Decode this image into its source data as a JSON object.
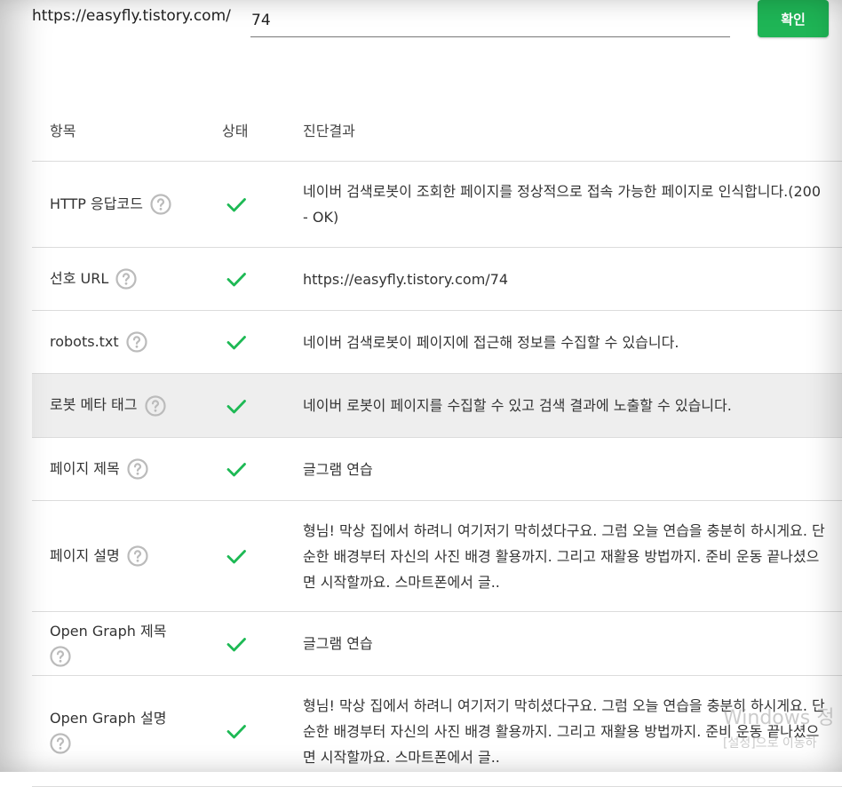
{
  "url_bar": {
    "prefix": "https://easyfly.tistory.com/",
    "value": "74",
    "confirm_label": "확인"
  },
  "table": {
    "headers": {
      "item": "항목",
      "status": "상태",
      "result": "진단결과"
    },
    "rows": [
      {
        "item": "HTTP 응답코드",
        "status": "ok",
        "result": "네이버 검색로봇이 조회한 페이지를 정상적으로 접속 가능한 페이지로 인식합니다.(200 - OK)"
      },
      {
        "item": "선호 URL",
        "status": "ok",
        "result": "https://easyfly.tistory.com/74"
      },
      {
        "item": "robots.txt",
        "status": "ok",
        "result": "네이버 검색로봇이 페이지에 접근해 정보를 수집할 수 있습니다."
      },
      {
        "item": "로봇 메타 태그",
        "status": "ok",
        "result": "네이버 로봇이 페이지를 수집할 수 있고 검색 결과에 노출할 수 있습니다."
      },
      {
        "item": "페이지 제목",
        "status": "ok",
        "result": "글그램 연습"
      },
      {
        "item": "페이지 설명",
        "status": "ok",
        "result": "형님! 막상 집에서 하려니 여기저기 막히셨다구요. 그럼 오늘 연습을 충분히 하시게요. 단순한 배경부터 자신의 사진 배경 활용까지. 그리고 재활용 방법까지. 준비 운동 끝나셨으면 시작할까요. 스마트폰에서 글.."
      },
      {
        "item": "Open Graph 제목",
        "status": "ok",
        "result": "글그램 연습"
      },
      {
        "item": "Open Graph 설명",
        "status": "ok",
        "result": "형님! 막상 집에서 하려니 여기저기 막히셨다구요. 그럼 오늘 연습을 충분히 하시게요. 단순한 배경부터 자신의 사진 배경 활용까지. 그리고 재활용 방법까지. 준비 운동 끝나셨으면 시작할까요. 스마트폰에서 글.."
      }
    ]
  },
  "icons": {
    "help": "question-circle-icon",
    "status_ok": "check-icon"
  },
  "colors": {
    "accent": "#1fb556",
    "check": "#1db954",
    "help_icon": "#bbbbbb",
    "highlight_row": "#eeeeee"
  },
  "os_watermark": {
    "line1": "Windows 정",
    "line2": "[설정]으로 이동하"
  }
}
